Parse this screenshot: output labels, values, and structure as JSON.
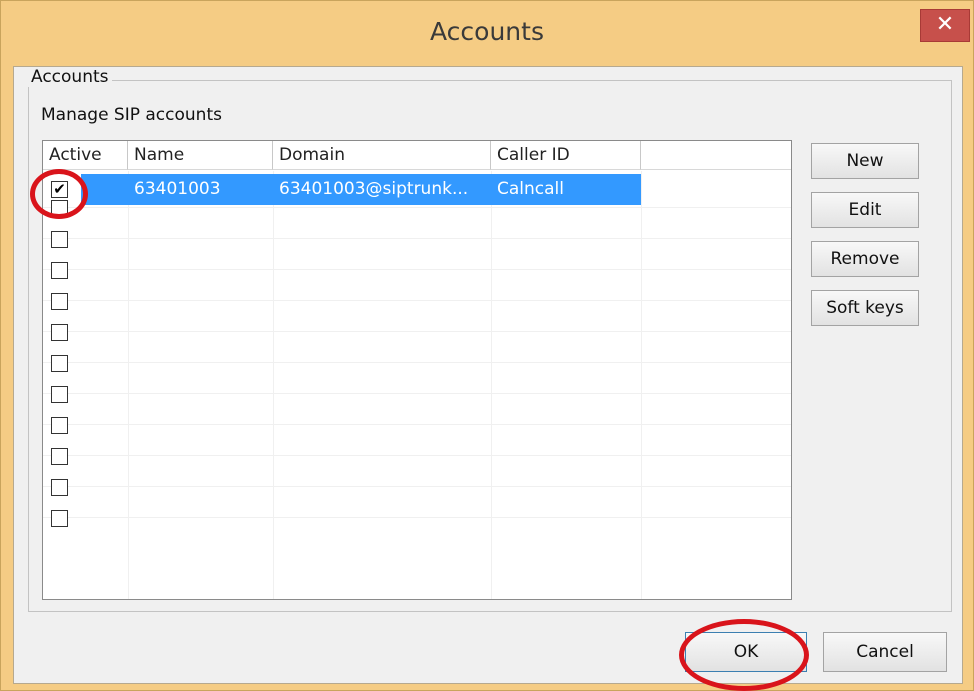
{
  "window": {
    "title": "Accounts",
    "close_glyph": "✕"
  },
  "group": {
    "legend": "Accounts",
    "description": "Manage SIP accounts"
  },
  "columns": [
    "Active",
    "Name",
    "Domain",
    "Caller ID"
  ],
  "rows": [
    {
      "active": true,
      "name": "63401003",
      "domain": "63401003@siptrunk...",
      "caller_id": "Calncall"
    }
  ],
  "empty_row_checkboxes": 11,
  "side_buttons": {
    "new": "New",
    "edit": "Edit",
    "remove": "Remove",
    "soft_keys": "Soft keys"
  },
  "footer": {
    "ok": "OK",
    "cancel": "Cancel"
  },
  "check_glyph": "✔",
  "colors": {
    "title_bar": "#f5cc84",
    "selection": "#3399ff",
    "close_button": "#c7504b",
    "highlight_circle": "#d9141b"
  }
}
